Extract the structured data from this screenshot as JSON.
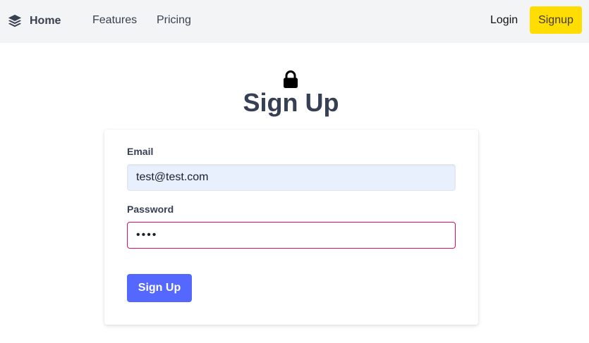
{
  "navbar": {
    "brand_label": "Home",
    "brand_icon": "layers-icon",
    "links": [
      "Features",
      "Pricing"
    ],
    "login_label": "Login",
    "signup_label": "Signup"
  },
  "page": {
    "title": "Sign Up",
    "title_icon": "lock-icon"
  },
  "form": {
    "email_label": "Email",
    "email_value": "test@test.com",
    "password_label": "Password",
    "password_value": "••••",
    "submit_label": "Sign Up"
  },
  "colors": {
    "navbar_bg": "#f3f4f6",
    "signup_button": "#ffdd00",
    "submit_button": "#5468ff",
    "password_border": "#e0104f",
    "email_bg": "#e8effd",
    "title_text": "#363f54"
  }
}
